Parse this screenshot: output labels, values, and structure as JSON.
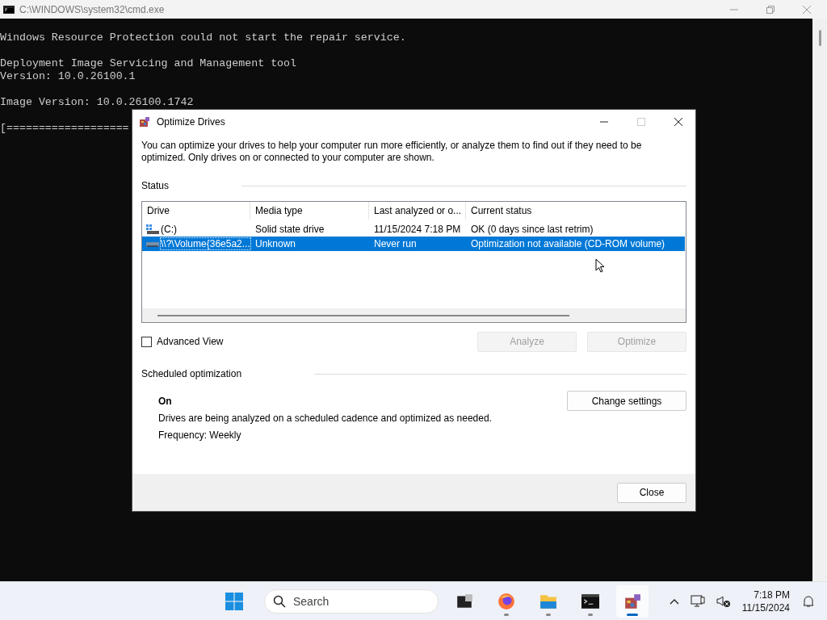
{
  "console_window": {
    "title": "C:\\WINDOWS\\system32\\cmd.exe",
    "paragraphs": [
      [
        "Windows Resource Protection could not start the repair service."
      ],
      [
        "Deployment Image Servicing and Management tool",
        "Version: 10.0.26100.1"
      ],
      [
        "Image Version: 10.0.26100.1742"
      ],
      [
        "[==================="
      ]
    ]
  },
  "dialog": {
    "title": "Optimize Drives",
    "description": "You can optimize your drives to help your computer run more efficiently, or analyze them to find out if they need to be optimized. Only drives on or connected to your computer are shown.",
    "status_label": "Status",
    "table": {
      "columns": [
        "Drive",
        "Media type",
        "Last analyzed or o...",
        "Current status"
      ],
      "rows": [
        {
          "kind": "ssd",
          "drive": "(C:)",
          "media_type": "Solid state drive",
          "last_analyzed": "11/15/2024 7:18 PM",
          "current_status": "OK (0 days since last retrim)",
          "selected": false
        },
        {
          "kind": "optical",
          "drive": "\\\\?\\Volume{36e5a2...",
          "media_type": "Unknown",
          "last_analyzed": "Never run",
          "current_status": "Optimization not available (CD-ROM volume)",
          "selected": true
        }
      ]
    },
    "advanced_view": {
      "label": "Advanced View",
      "checked": false
    },
    "action_buttons": [
      {
        "label": "Analyze",
        "disabled": true
      },
      {
        "label": "Optimize",
        "disabled": true
      }
    ],
    "scheduled": {
      "label": "Scheduled optimization",
      "state": "On",
      "description": "Drives are being analyzed on a scheduled cadence and optimized as needed.",
      "frequency": "Frequency: Weekly",
      "button": "Change settings"
    },
    "close_button": "Close"
  },
  "taskbar": {
    "search_placeholder": "Search",
    "apps": [
      {
        "kind": "task-view",
        "running": false,
        "selected": false
      },
      {
        "kind": "firefox",
        "running": true,
        "selected": false
      },
      {
        "kind": "explorer",
        "running": true,
        "selected": false
      },
      {
        "kind": "terminal",
        "running": true,
        "selected": false
      },
      {
        "kind": "defrag",
        "running": true,
        "selected": true
      }
    ],
    "time": "7:18 PM",
    "date": "11/15/2024"
  }
}
